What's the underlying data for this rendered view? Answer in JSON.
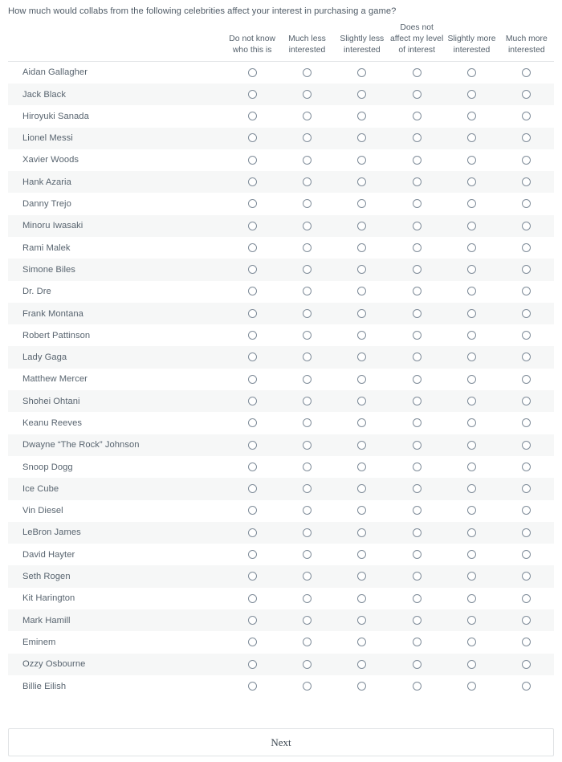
{
  "question": {
    "prompt": "How much would collabs from the following celebrities affect your interest in purchasing a game?"
  },
  "matrix": {
    "label_column_header": "",
    "columns": [
      "Do not know who this is",
      "Much less interested",
      "Slightly less interested",
      "Does not affect my level of interest",
      "Slightly more interested",
      "Much more interested"
    ],
    "rows": [
      "Aidan Gallagher",
      "Jack Black",
      "Hiroyuki Sanada",
      "Lionel Messi",
      "Xavier Woods",
      "Hank Azaria",
      "Danny Trejo",
      "Minoru Iwasaki",
      "Rami Malek",
      "Simone Biles",
      "Dr. Dre",
      "Frank Montana",
      "Robert Pattinson",
      "Lady Gaga",
      "Matthew Mercer",
      "Shohei Ohtani",
      "Keanu Reeves",
      "Dwayne “The Rock” Johnson",
      "Snoop Dogg",
      "Ice Cube",
      "Vin Diesel",
      "LeBron James",
      "David Hayter",
      "Seth Rogen",
      "Kit Harington",
      "Mark Hamill",
      "Eminem",
      "Ozzy Osbourne",
      "Billie Eilish"
    ]
  },
  "footer": {
    "next_label": "Next"
  },
  "theme": {
    "text_color": "#58646f",
    "stripe_color": "#f6f7f7",
    "border_color": "#e3e6e8",
    "radio_border": "#7f8c99",
    "background": "#ffffff"
  }
}
